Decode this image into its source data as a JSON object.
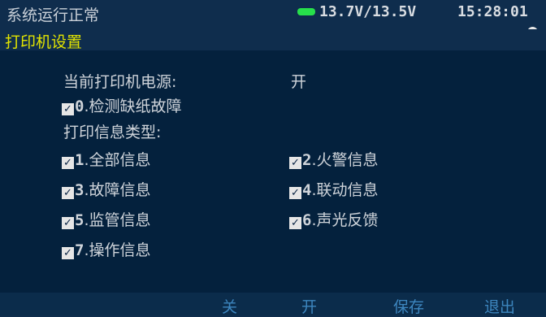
{
  "status": {
    "system_state": "系统运行正常",
    "voltage": "13.7V/13.5V",
    "time": "15:28:01",
    "battery_color": "#27e04b"
  },
  "page": {
    "title": "打印机设置"
  },
  "printer": {
    "power_label": "当前打印机电源:",
    "power_value": "开",
    "option0_num": "0",
    "option0_label": ".检测缺纸故障",
    "info_type_label": "打印信息类型:"
  },
  "info_options": [
    {
      "num": "1",
      "label": ".全部信息",
      "checked": true
    },
    {
      "num": "2",
      "label": ".火警信息",
      "checked": true
    },
    {
      "num": "3",
      "label": ".故障信息",
      "checked": true
    },
    {
      "num": "4",
      "label": ".联动信息",
      "checked": true
    },
    {
      "num": "5",
      "label": ".监管信息",
      "checked": true
    },
    {
      "num": "6",
      "label": ".声光反馈",
      "checked": true
    },
    {
      "num": "7",
      "label": ".操作信息",
      "checked": true
    }
  ],
  "softkeys": {
    "off": "关",
    "on": "开",
    "save": "保存",
    "exit": "退出"
  },
  "colors": {
    "title": "#e2e400",
    "softkey": "#3d86bf",
    "content_bg": "#04213d"
  }
}
